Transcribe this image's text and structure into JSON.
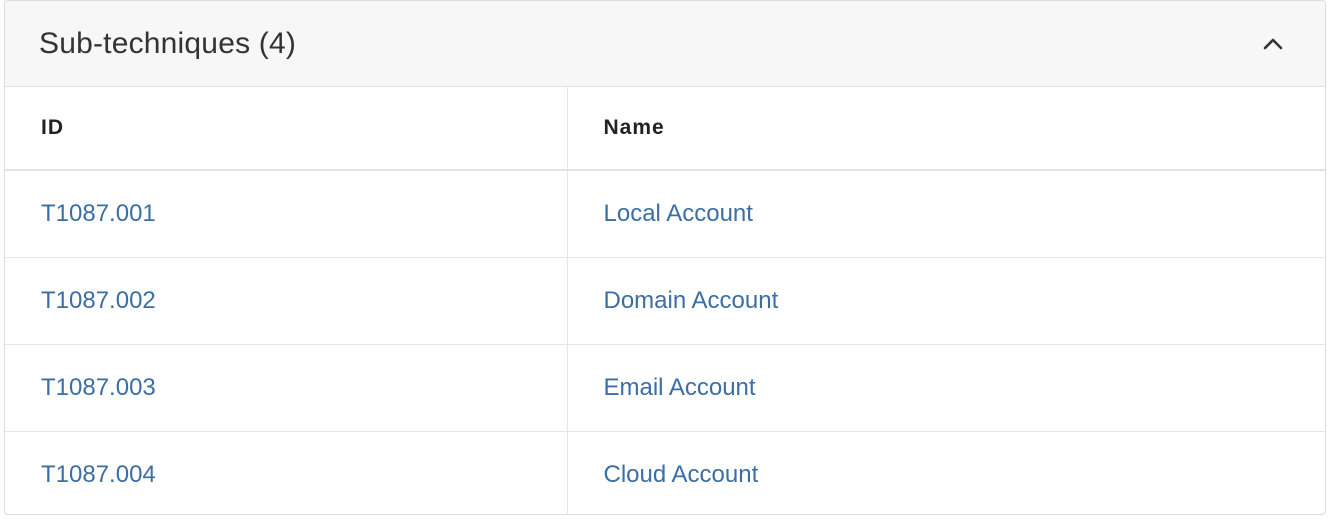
{
  "panel": {
    "title": "Sub-techniques (4)",
    "collapse_icon": "chevron-up-icon"
  },
  "table": {
    "headers": [
      "ID",
      "Name"
    ],
    "rows": [
      {
        "id": "T1087.001",
        "name": "Local Account"
      },
      {
        "id": "T1087.002",
        "name": "Domain Account"
      },
      {
        "id": "T1087.003",
        "name": "Email Account"
      },
      {
        "id": "T1087.004",
        "name": "Cloud Account"
      }
    ]
  },
  "colors": {
    "link": "#3b6ea5",
    "header_bg": "#f7f7f7"
  }
}
